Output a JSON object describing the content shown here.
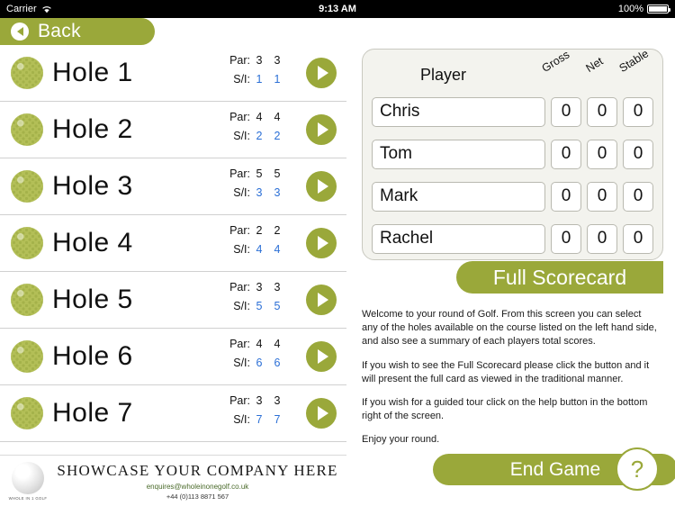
{
  "statusbar": {
    "carrier": "Carrier",
    "wifi_icon": "wifi-icon",
    "time": "9:13 AM",
    "battery_percent": "100%",
    "battery_icon": "battery-full-icon"
  },
  "navbar": {
    "back_label": "Back",
    "back_icon": "back-chevron-icon"
  },
  "holes": [
    {
      "name": "Hole 1",
      "par_label": "Par:",
      "par": [
        "3",
        "3"
      ],
      "si_label": "S/I:",
      "si": [
        "1",
        "1"
      ]
    },
    {
      "name": "Hole 2",
      "par_label": "Par:",
      "par": [
        "4",
        "4"
      ],
      "si_label": "S/I:",
      "si": [
        "2",
        "2"
      ]
    },
    {
      "name": "Hole 3",
      "par_label": "Par:",
      "par": [
        "5",
        "5"
      ],
      "si_label": "S/I:",
      "si": [
        "3",
        "3"
      ]
    },
    {
      "name": "Hole 4",
      "par_label": "Par:",
      "par": [
        "2",
        "2"
      ],
      "si_label": "S/I:",
      "si": [
        "4",
        "4"
      ]
    },
    {
      "name": "Hole 5",
      "par_label": "Par:",
      "par": [
        "3",
        "3"
      ],
      "si_label": "S/I:",
      "si": [
        "5",
        "5"
      ]
    },
    {
      "name": "Hole 6",
      "par_label": "Par:",
      "par": [
        "4",
        "4"
      ],
      "si_label": "S/I:",
      "si": [
        "6",
        "6"
      ]
    },
    {
      "name": "Hole 7",
      "par_label": "Par:",
      "par": [
        "3",
        "3"
      ],
      "si_label": "S/I:",
      "si": [
        "7",
        "7"
      ]
    }
  ],
  "advert": {
    "headline": "SHOWCASE YOUR COMPANY HERE",
    "email": "enquires@wholeinonegolf.co.uk",
    "phone": "+44 (0)113 8871 567",
    "logo_caption": "WHOLE IN 1 GOLF"
  },
  "scorecard": {
    "player_header": "Player",
    "col_gross": "Gross",
    "col_net": "Net",
    "col_stable": "Stable",
    "players": [
      {
        "name": "Chris",
        "gross": "0",
        "net": "0",
        "stable": "0"
      },
      {
        "name": "Tom",
        "gross": "0",
        "net": "0",
        "stable": "0"
      },
      {
        "name": "Mark",
        "gross": "0",
        "net": "0",
        "stable": "0"
      },
      {
        "name": "Rachel",
        "gross": "0",
        "net": "0",
        "stable": "0"
      }
    ],
    "full_scorecard_label": "Full Scorecard"
  },
  "blurb": {
    "p1": "Welcome to your round of Golf. From this screen you can select any of the holes available on the course listed on the left hand side, and also see a summary of each players total scores.",
    "p2": "If you wish to see the Full Scorecard please click the button and it will present the full card as viewed in the traditional manner.",
    "p3": "If you wish for a guided tour click on the help button in the bottom right of the screen.",
    "p4": "Enjoy your round."
  },
  "footer": {
    "end_game_label": "End Game",
    "help_label": "?"
  },
  "colors": {
    "accent": "#9aa83a",
    "blue": "#2b6fd6",
    "panel": "#f3f3ee"
  }
}
